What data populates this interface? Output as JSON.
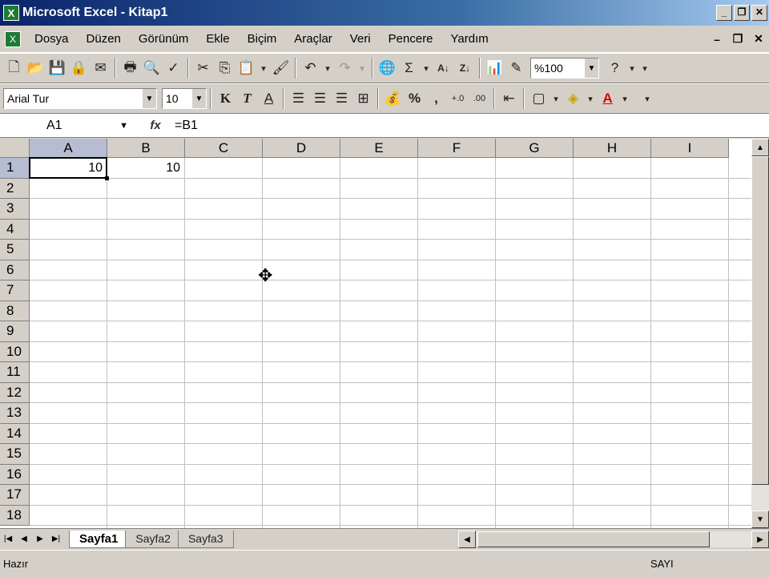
{
  "window": {
    "title": "Microsoft Excel - Kitap1",
    "app_icon": "X"
  },
  "menu": {
    "items": [
      "Dosya",
      "Düzen",
      "Görünüm",
      "Ekle",
      "Biçim",
      "Araçlar",
      "Veri",
      "Pencere",
      "Yardım"
    ]
  },
  "standard_toolbar": {
    "zoom": "%100",
    "buttons": [
      "new",
      "open",
      "save",
      "permission",
      "print",
      "print-preview",
      "spelling",
      "cut",
      "copy",
      "paste",
      "format-painter",
      "undo",
      "redo",
      "hyperlink",
      "autosum",
      "sort-ascending",
      "sort-descending",
      "chart-wizard",
      "drawing",
      "help"
    ]
  },
  "formatting_toolbar": {
    "font": "Arial Tur",
    "size": "10",
    "bold": "K",
    "italic": "T",
    "underline": "A",
    "percent": "%",
    "comma": ","
  },
  "formula_bar": {
    "name_box": "A1",
    "fx": "fx",
    "formula": "=B1"
  },
  "grid": {
    "columns": [
      "A",
      "B",
      "C",
      "D",
      "E",
      "F",
      "G",
      "H",
      "I"
    ],
    "rows": [
      "1",
      "2",
      "3",
      "4",
      "5",
      "6",
      "7",
      "8",
      "9",
      "10",
      "11",
      "12",
      "13",
      "14",
      "15",
      "16",
      "17",
      "18"
    ],
    "active_cell": "A1",
    "cells": {
      "A1": "10",
      "B1": "10"
    }
  },
  "sheets": {
    "tabs": [
      "Sayfa1",
      "Sayfa2",
      "Sayfa3"
    ],
    "active": "Sayfa1"
  },
  "status": {
    "left": "Hazır",
    "right": "SAYI"
  }
}
